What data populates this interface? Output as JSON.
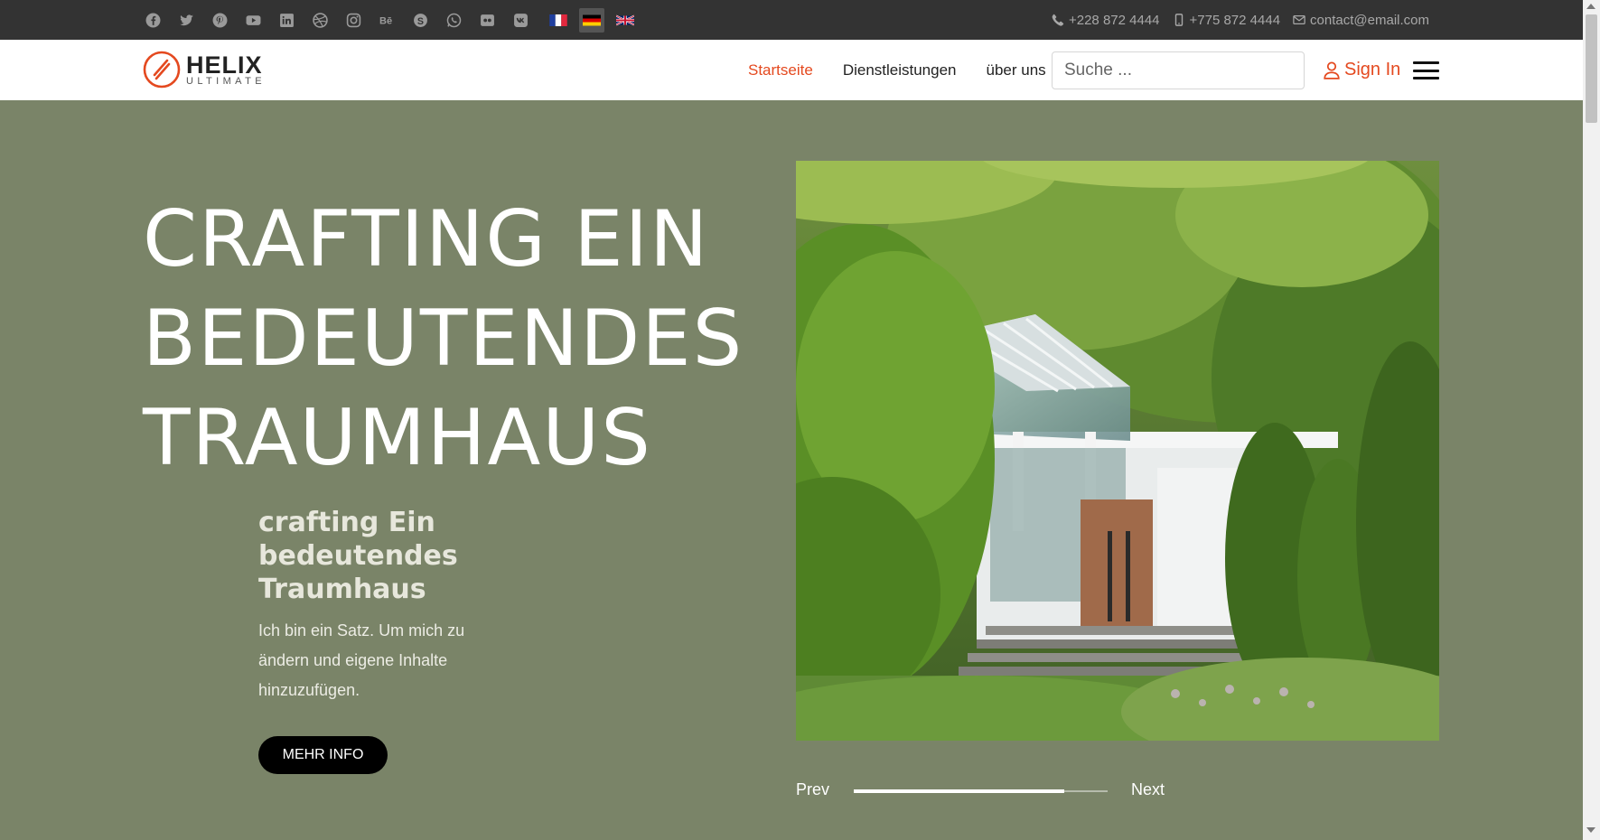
{
  "topbar": {
    "social_icons": [
      "facebook-icon",
      "twitter-icon",
      "pinterest-icon",
      "youtube-icon",
      "linkedin-icon",
      "dribbble-icon",
      "instagram-icon",
      "behance-icon",
      "skype-icon",
      "whatsapp-icon",
      "flickr-icon",
      "vk-icon"
    ],
    "languages": [
      {
        "code": "fr",
        "active": false
      },
      {
        "code": "de",
        "active": true
      },
      {
        "code": "en",
        "active": false
      }
    ],
    "phone": "+228 872 4444",
    "mobile": "+775 872 4444",
    "email": "contact@email.com"
  },
  "header": {
    "logo_main": "HELIX",
    "logo_sub": "ULTIMATE",
    "nav": [
      {
        "label": "Startseite",
        "active": true
      },
      {
        "label": "Dienstleistungen",
        "active": false
      },
      {
        "label": "über uns",
        "active": false
      }
    ],
    "search_placeholder": "Suche ...",
    "signin_label": "Sign In",
    "accent_color": "#e4491f"
  },
  "hero": {
    "title_lines": [
      "CRAFTING EIN",
      "BEDEUTENDES",
      "TRAUMHAUS"
    ],
    "subtitle": "crafting Ein bedeutendes Traumhaus",
    "description": "Ich bin ein Satz. Um mich zu ändern und eigene Inhalte hinzuzufügen.",
    "button_label": "MEHR INFO",
    "background_color": "#7a8468"
  },
  "slider": {
    "prev_label": "Prev",
    "next_label": "Next",
    "progress": 0.83
  }
}
